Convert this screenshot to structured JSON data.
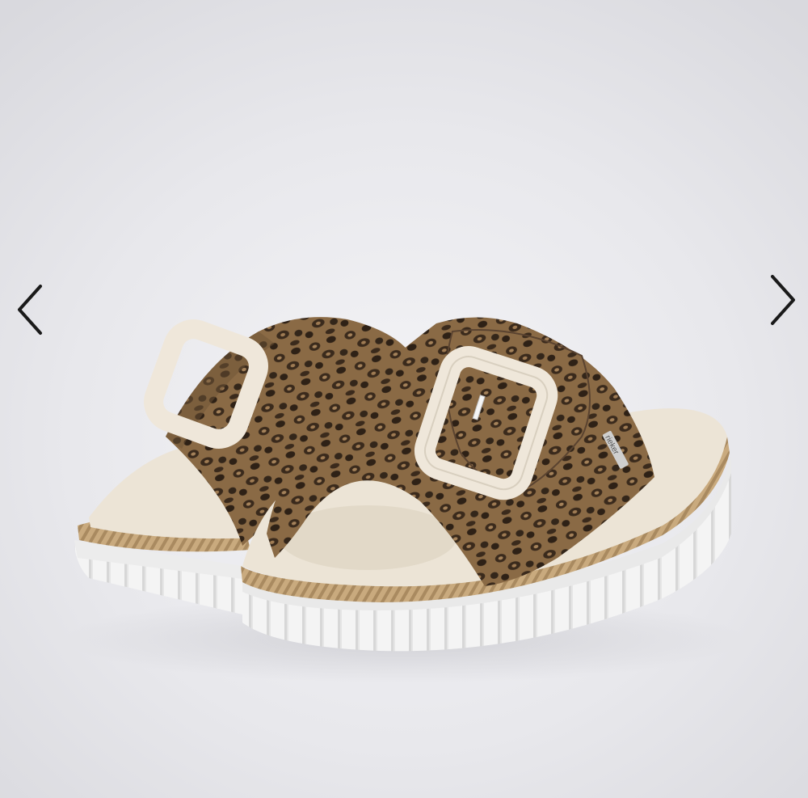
{
  "gallery": {
    "prev_icon": "chevron-left-icon",
    "next_icon": "chevron-right-icon",
    "arrow_color": "#1a1a1a",
    "background_color": "#e6e6ea"
  },
  "product": {
    "brand_tag": "rieker",
    "upper_pattern": "leopard print",
    "buckle_color": "#efe7da",
    "sole_color": "#f3f3f3",
    "rope_trim_color": "#c9aa7e"
  }
}
